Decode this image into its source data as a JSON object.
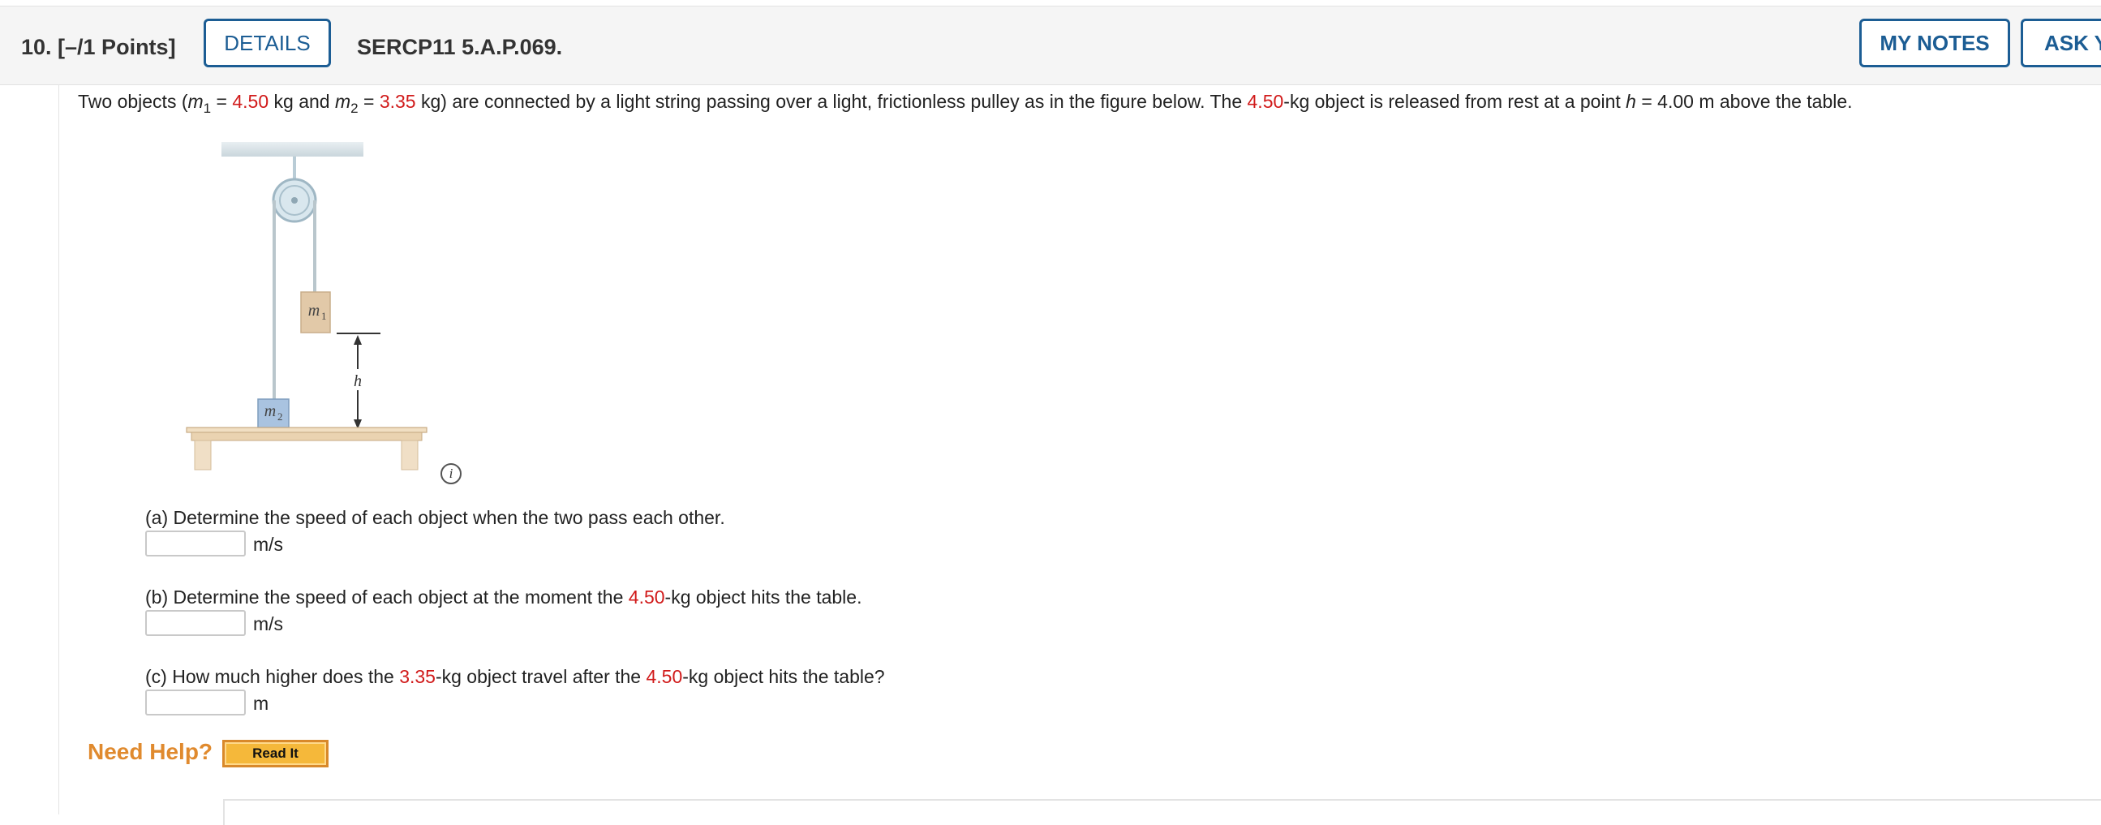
{
  "header": {
    "question_number": "10.  [–/1 Points]",
    "details_label": "DETAILS",
    "question_id": "SERCP11 5.A.P.069.",
    "my_notes_label": "MY NOTES",
    "ask_label": "ASK Y"
  },
  "prompt": {
    "t1": "Two objects (",
    "m1_sym": "m",
    "m1_sub": "1",
    "t2": " = ",
    "m1_val": "4.50",
    "t3": " kg and ",
    "m2_sym": "m",
    "m2_sub": "2",
    "t4": " = ",
    "m2_val": "3.35",
    "t5": " kg) are connected by a light string passing over a light, frictionless pulley as in the figure below. The ",
    "m1_val2": "4.50",
    "t6": "-kg object is released from rest at a point ",
    "h_sym": "h",
    "t7": " = 4.00 m above the table."
  },
  "figure": {
    "m1_label": "m",
    "m1_sub": "1",
    "m2_label": "m",
    "m2_sub": "2",
    "h_label": "h",
    "info_glyph": "i"
  },
  "parts": {
    "a": {
      "text": "(a) Determine the speed of each object when the two pass each other.",
      "unit": "m/s",
      "value": ""
    },
    "b": {
      "t1": "(b) Determine the speed of each object at the moment the ",
      "red1": "4.50",
      "t2": "-kg object hits the table.",
      "unit": "m/s",
      "value": ""
    },
    "c": {
      "t1": "(c) How much higher does the ",
      "red1": "3.35",
      "t2": "-kg object travel after the ",
      "red2": "4.50",
      "t3": "-kg object hits the table?",
      "unit": "m",
      "value": ""
    }
  },
  "help": {
    "need_help": "Need Help?",
    "read_it": "Read It"
  },
  "colors": {
    "accent": "#1c5d94",
    "highlight_red": "#d11b1b",
    "help_orange": "#e08a2e"
  }
}
